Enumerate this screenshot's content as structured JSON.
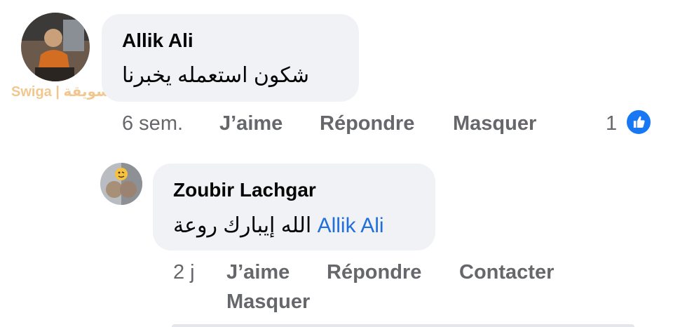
{
  "watermark": "Swiga | سويقة",
  "comments": [
    {
      "author": "Allik Ali",
      "text": "شكون استعمله يخبرنا",
      "time": "6 sem.",
      "like_label": "J’aime",
      "reply_label": "Répondre",
      "hide_label": "Masquer",
      "reaction_count": "1",
      "reaction_icon": "thumbs-up-icon",
      "colors": {
        "reaction": "#1877f2"
      }
    },
    {
      "author": "Zoubir Lachgar",
      "text": "الله إيبارك روعة",
      "mention": "Allik Ali",
      "time": "2 j",
      "like_label": "J’aime",
      "reply_label": "Répondre",
      "contact_label": "Contacter",
      "hide_label": "Masquer",
      "colors": {
        "mention": "#216fdb"
      }
    }
  ],
  "colors": {
    "bubble": "#f0f2f5",
    "meta": "#65676b"
  }
}
